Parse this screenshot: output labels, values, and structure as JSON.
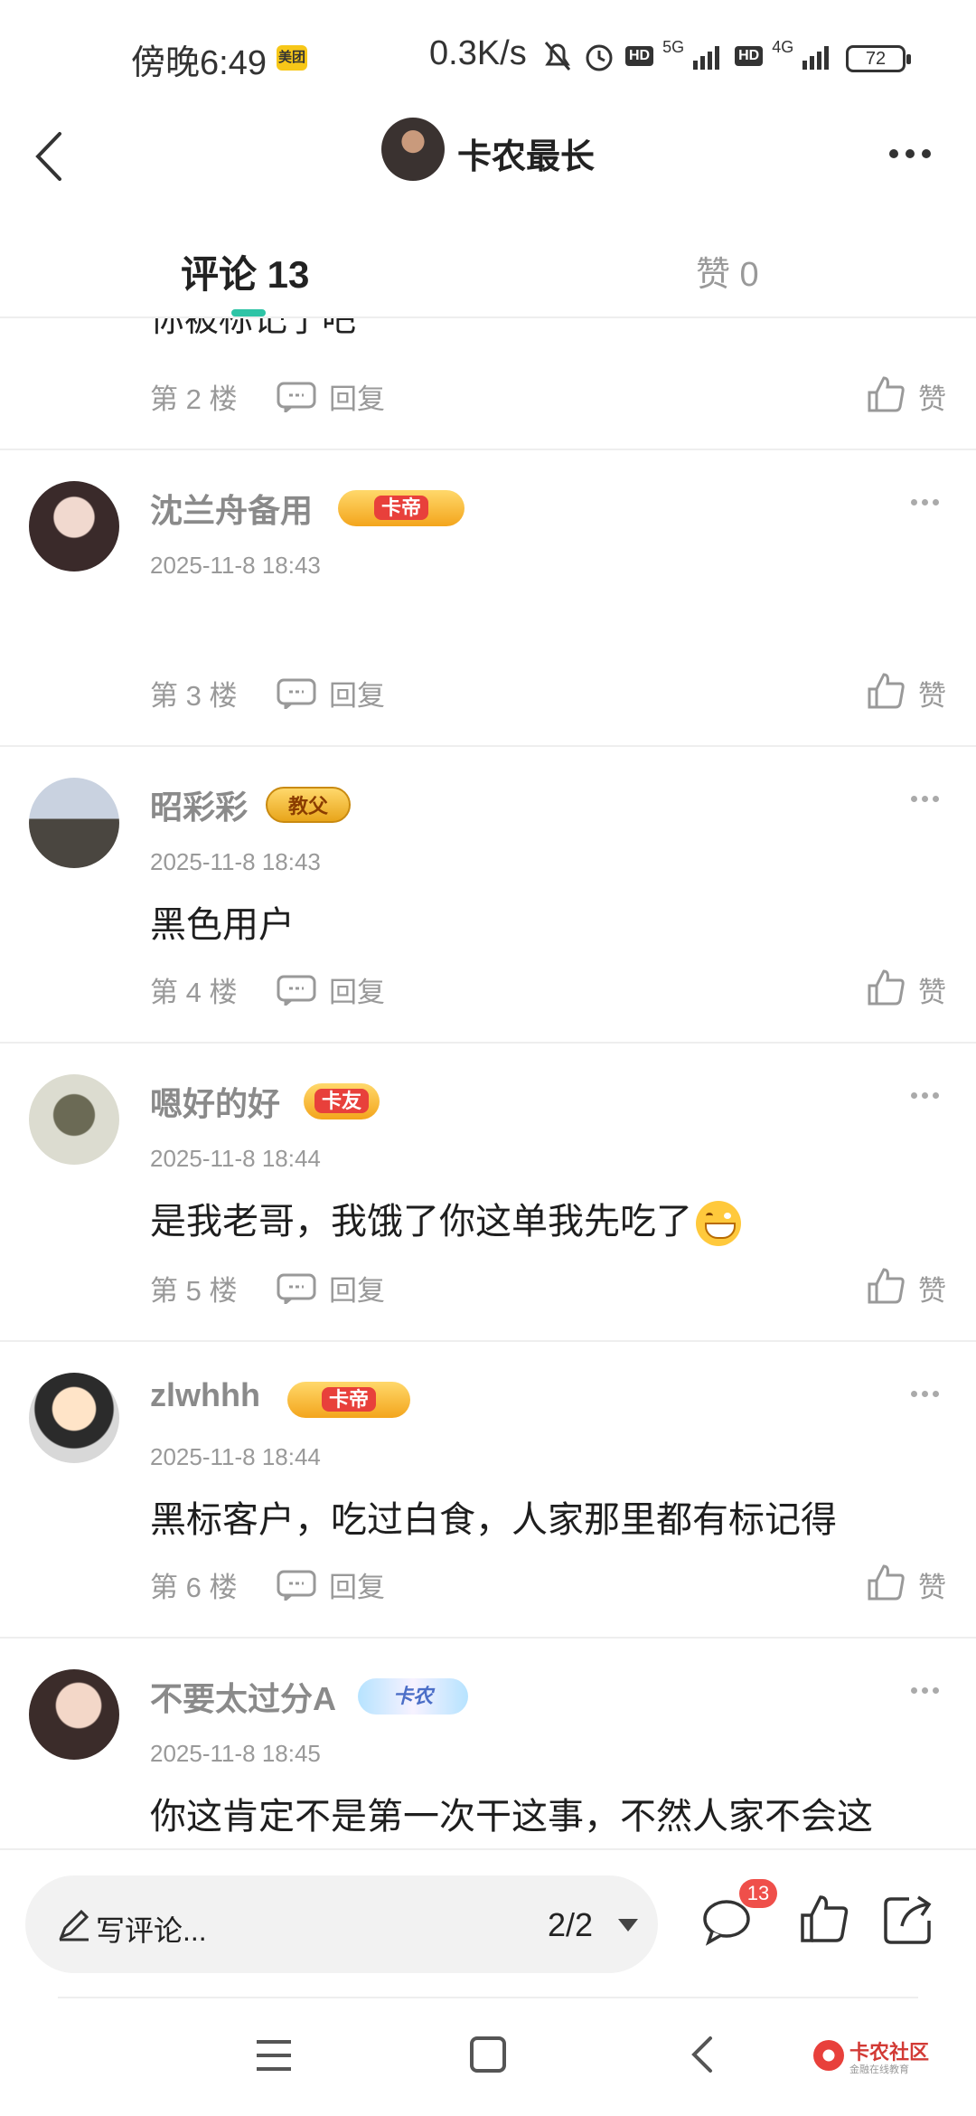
{
  "status_bar": {
    "time": "傍晚6:49",
    "meituan_label": "美团",
    "net_speed": "0.3K/s",
    "hd1": "HD",
    "net1": "5G",
    "hd2": "HD",
    "net2": "4G",
    "battery": "72"
  },
  "header": {
    "title": "卡农最长"
  },
  "tabs": {
    "comments_label": "评论 13",
    "likes_label": "赞 0"
  },
  "list": {
    "clipped_text": "你被标记了吧",
    "first_floor": "第 2 楼",
    "reply_label": "回复",
    "like_label": "赞",
    "comments": [
      {
        "username": "沈兰舟备用",
        "badge": "卡帝",
        "timestamp": "2025-11-8 18:43",
        "content": "",
        "floor": "第 3 楼"
      },
      {
        "username": "昭彩彩",
        "badge": "教父",
        "timestamp": "2025-11-8 18:43",
        "content": "黑色用户",
        "floor": "第 4 楼"
      },
      {
        "username": "嗯好的好",
        "badge": "卡友",
        "timestamp": "2025-11-8 18:44",
        "content": "是我老哥，我饿了你这单我先吃了",
        "floor": "第 5 楼"
      },
      {
        "username": "zlwhhh",
        "badge": "卡帝",
        "timestamp": "2025-11-8 18:44",
        "content": "黑标客户，吃过白食，人家那里都有标记得",
        "floor": "第 6 楼"
      },
      {
        "username": "不要太过分A",
        "badge": "卡农",
        "timestamp": "2025-11-8 18:45",
        "content": "你这肯定不是第一次干这事，不然人家不会这",
        "floor": ""
      }
    ]
  },
  "bottom_bar": {
    "write_placeholder": "写评论...",
    "page_indicator": "2/2",
    "comment_count": "13"
  },
  "watermark": {
    "text": "卡农社区",
    "sub": "金融在线教育"
  },
  "colors": {
    "accent": "#2ec4a6",
    "badge_red": "#ef4f4a",
    "muted_text": "#999999"
  }
}
